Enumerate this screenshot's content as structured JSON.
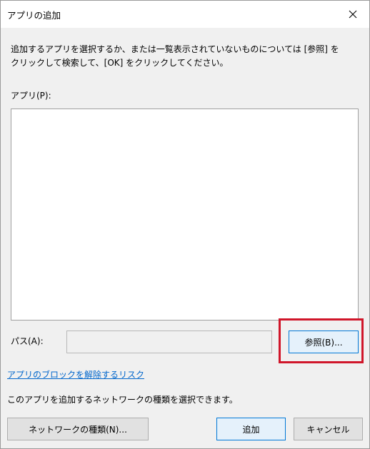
{
  "window": {
    "title": "アプリの追加",
    "close_icon": "close-icon"
  },
  "instruction": {
    "line1": "追加するアプリを選択するか、または一覧表示されていないものについては [参照] を",
    "line2": "クリックして検索して、[OK] をクリックしてください。"
  },
  "apps": {
    "label": "アプリ(P):",
    "items": []
  },
  "path": {
    "label": "パス(A):",
    "value": "",
    "browse_label": "参照(B)..."
  },
  "highlight_color": "#d0162a",
  "risk_link": "アプリのブロックを解除するリスク",
  "network": {
    "text": "このアプリを追加するネットワークの種類を選択できます。",
    "button_label": "ネットワークの種類(N)..."
  },
  "buttons": {
    "add": "追加",
    "cancel": "キャンセル"
  }
}
